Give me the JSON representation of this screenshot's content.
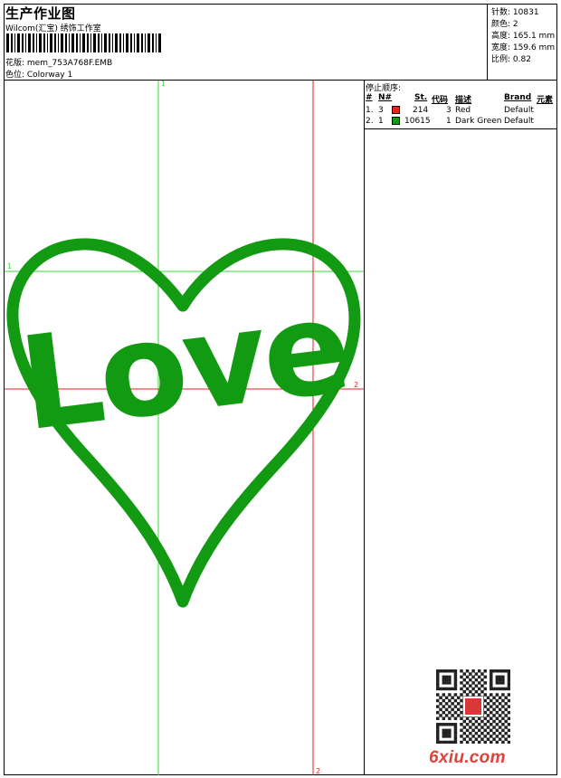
{
  "header": {
    "title": "生产作业图",
    "subtitle": "Wilcom(汇宝) 绣饰工作室",
    "pattern_label": "花版: mem_753A768F.EMB",
    "colorway_label": "色位: Colorway 1"
  },
  "stats": [
    {
      "label": "针数",
      "value": "10831"
    },
    {
      "label": "颜色",
      "value": "2"
    },
    {
      "label": "高度",
      "value": "165.1 mm"
    },
    {
      "label": "宽度",
      "value": "159.6 mm"
    },
    {
      "label": "比例",
      "value": "0.82"
    }
  ],
  "stop_sequence": {
    "title": "停止顺序:",
    "headers": {
      "idx": "#",
      "no": "N#",
      "st": "St.",
      "code": "代码",
      "desc": "描述",
      "brand": "Brand",
      "element": "元素"
    },
    "rows": [
      {
        "idx": "1.",
        "no": "3",
        "color": "#e8251c",
        "st": "214",
        "code": "3",
        "desc": "Red",
        "brand": "Default"
      },
      {
        "idx": "2.",
        "no": "1",
        "color": "#129a12",
        "st": "10615",
        "code": "1",
        "desc": "Dark Green",
        "brand": "Default"
      }
    ]
  },
  "design": {
    "text": "Love",
    "heart_color": "#129a12",
    "text_color": "#129a12",
    "guide_green": "#33dd33",
    "guide_red": "#e02020",
    "guide_labels": {
      "top": "1",
      "left": "1",
      "right": "2",
      "bottom": "2"
    }
  },
  "watermark": "6xiu.com"
}
